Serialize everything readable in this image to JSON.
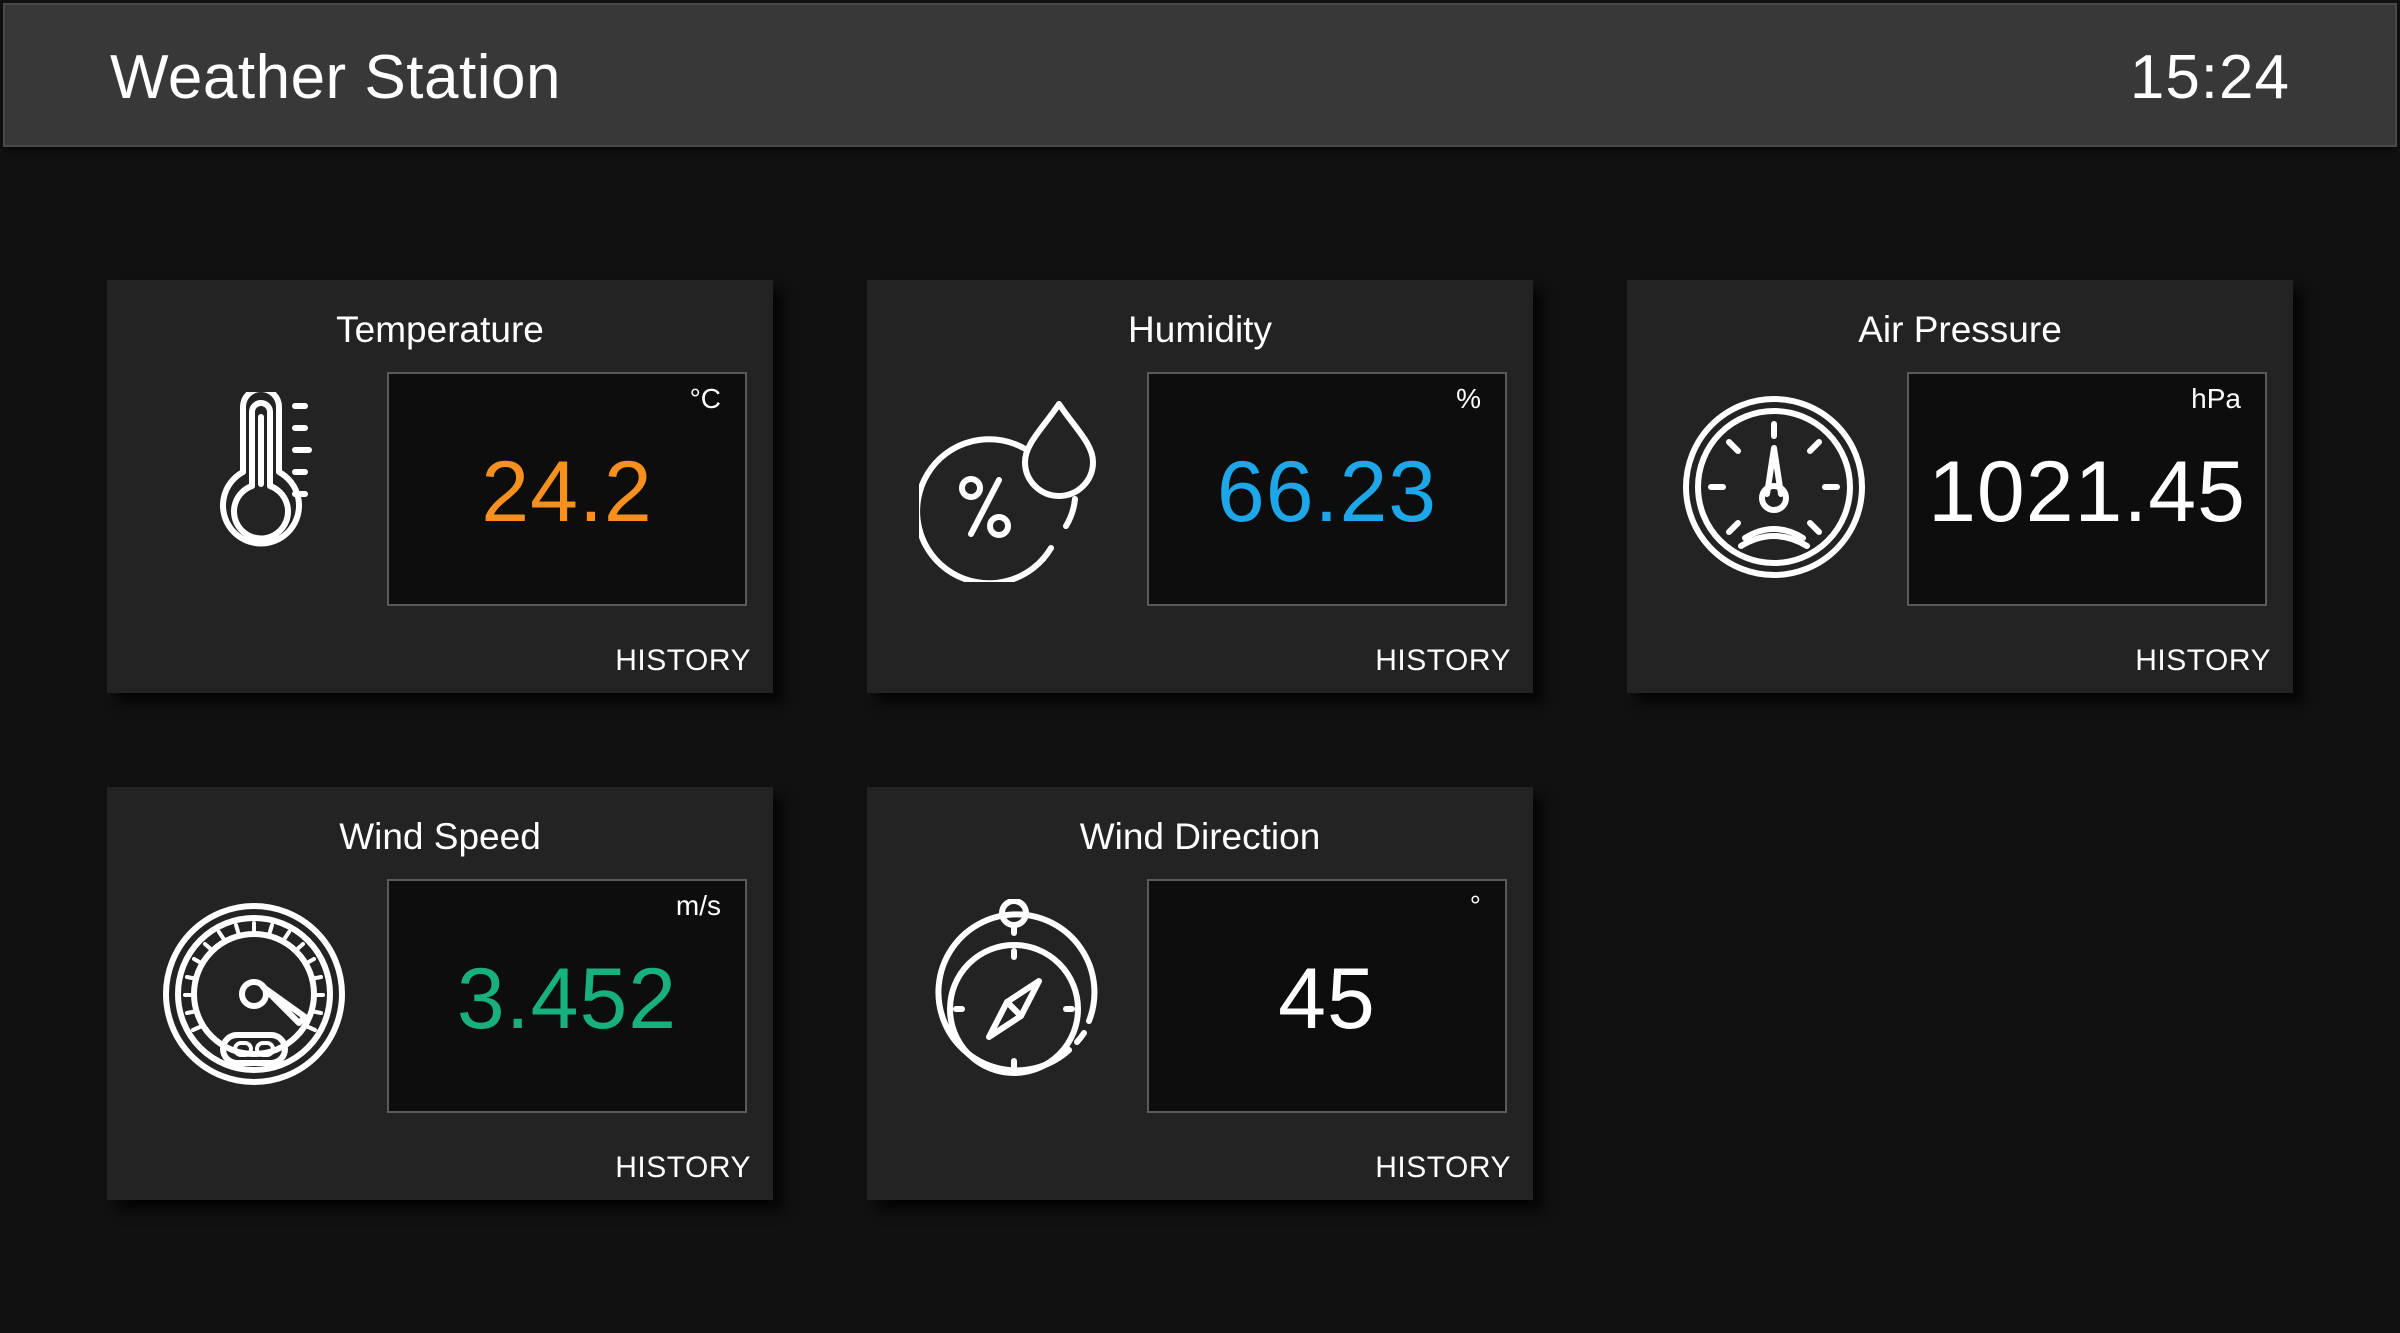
{
  "app": {
    "title": "Weather Station",
    "time": "15:24"
  },
  "colors": {
    "background": "#111111",
    "header": "#383838",
    "card": "#232323",
    "temperature": "#f7901e",
    "humidity": "#1ea7e8",
    "pressure": "#ffffff",
    "wind_speed": "#17b07e",
    "wind_direction": "#ffffff"
  },
  "cards": {
    "temperature": {
      "title": "Temperature",
      "unit": "°C",
      "value": "24.2",
      "history": "HISTORY",
      "icon": "thermometer-icon"
    },
    "humidity": {
      "title": "Humidity",
      "unit": "%",
      "value": "66.23",
      "history": "HISTORY",
      "icon": "humidity-icon"
    },
    "pressure": {
      "title": "Air Pressure",
      "unit": "hPa",
      "value": "1021.45",
      "history": "HISTORY",
      "icon": "pressure-gauge-icon"
    },
    "wind_speed": {
      "title": "Wind Speed",
      "unit": "m/s",
      "value": "3.452",
      "history": "HISTORY",
      "icon": "speedometer-icon"
    },
    "wind_direction": {
      "title": "Wind Direction",
      "unit": "°",
      "value": "45",
      "history": "HISTORY",
      "icon": "compass-icon"
    }
  }
}
